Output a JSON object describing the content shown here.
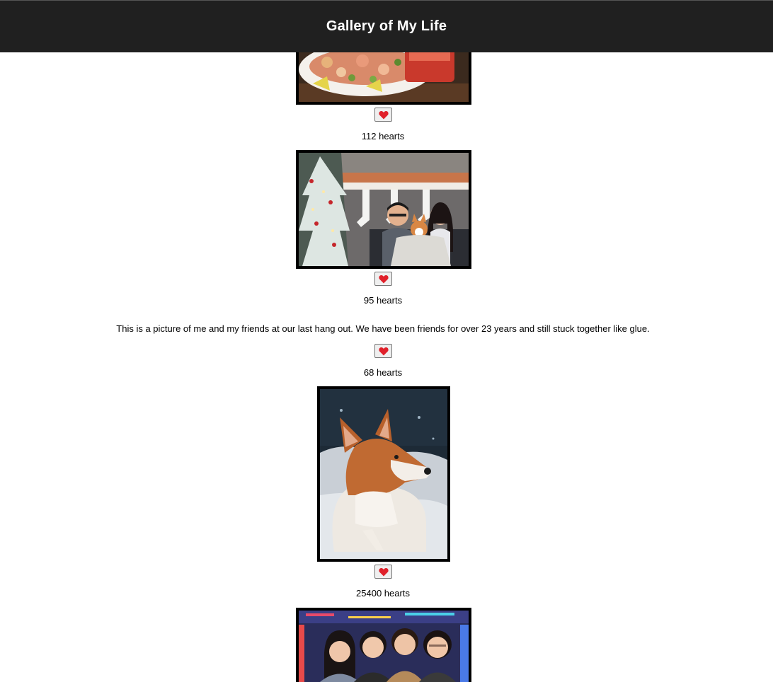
{
  "header": {
    "title": "Gallery of My Life"
  },
  "posts": [
    {
      "id": "food",
      "image": "food-platter-photo",
      "hearts": "112 hearts"
    },
    {
      "id": "holiday",
      "image": "christmas-family-photo",
      "hearts": "95 hearts"
    },
    {
      "id": "friends-text",
      "caption": "This is a picture of me and my friends at our last hang out. We have been friends for over 23 years and still stuck together like glue.",
      "hearts": "68 hearts"
    },
    {
      "id": "corgi",
      "image": "corgi-snow-photo",
      "hearts": "25400 hearts"
    },
    {
      "id": "group",
      "image": "friends-group-photo"
    }
  ],
  "icons": {
    "like": "heart-icon"
  },
  "colors": {
    "header_bg": "#202020",
    "header_text": "#ffffff",
    "heart": "#e0202a",
    "frame": "#000000"
  }
}
